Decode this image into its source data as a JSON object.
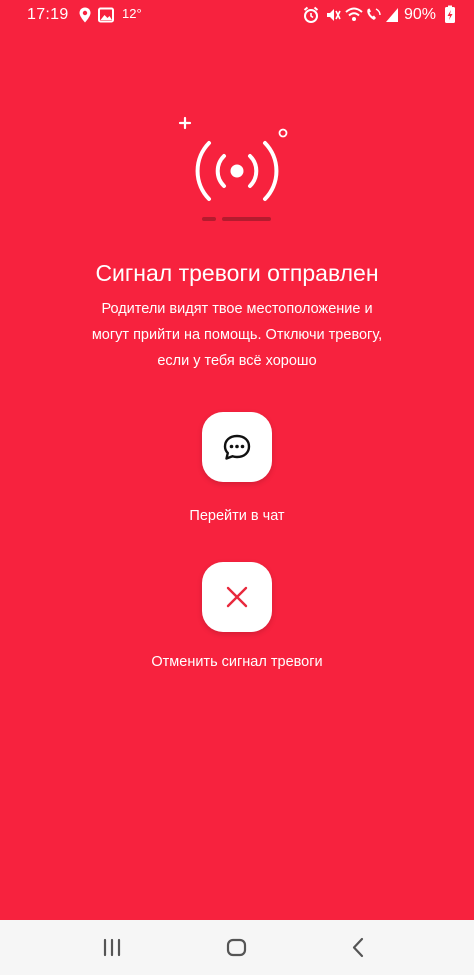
{
  "status_bar": {
    "time": "17:19",
    "temperature": "12°",
    "battery": "90%"
  },
  "alarm": {
    "title": "Сигнал тревоги отправлен",
    "description": "Родители видят твое местоположение и могут прийти на помощь. Отключи тревогу, если у тебя всё хорошо"
  },
  "actions": {
    "chat_label": "Перейти в чат",
    "cancel_label": "Отменить сигнал тревоги"
  },
  "colors": {
    "background": "#f7223e",
    "button_bg": "#ffffff",
    "cancel_icon": "#e8283c"
  },
  "icons": {
    "hero": "broadcast-signal-icon",
    "chat": "chat-bubble-icon",
    "cancel": "close-icon"
  }
}
